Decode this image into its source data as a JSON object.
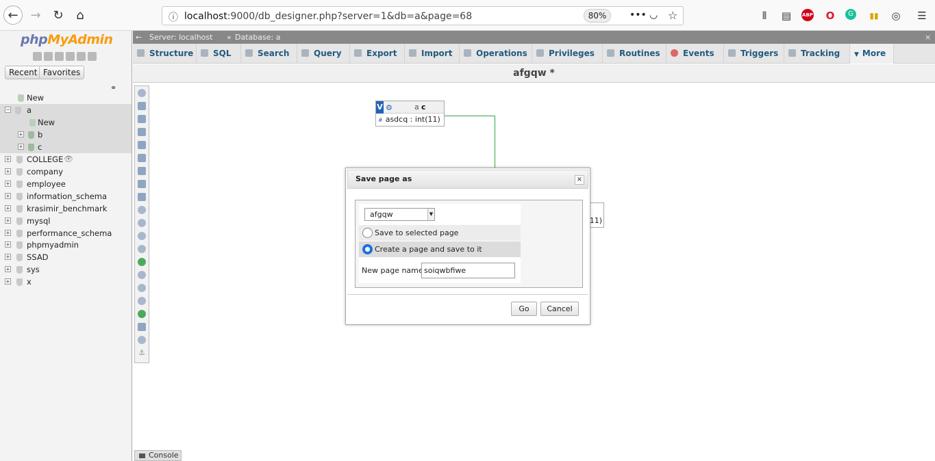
{
  "browser": {
    "url_prefix": "localhost",
    "url_rest": ":9000/db_designer.php?server=1&db=a&page=68",
    "zoom": "80%",
    "icons": [
      "back-icon",
      "forward-icon",
      "reload-icon",
      "home-icon",
      "info-icon",
      "more-icon",
      "pocket-icon",
      "star-icon",
      "library-icon",
      "sidebar-icon",
      "adblock-icon",
      "opera-icon",
      "grammarly-icon",
      "extension-icon",
      "account-icon",
      "menu-icon"
    ]
  },
  "nav": {
    "logo_php": "php",
    "logo_myadmin": "MyAdmin",
    "tabs": {
      "recent": "Recent",
      "favorites": "Favorites"
    },
    "tree": [
      {
        "label": "New"
      },
      {
        "label": "a"
      },
      {
        "label": "New"
      },
      {
        "label": "b"
      },
      {
        "label": "c"
      },
      {
        "label": "COLLEGE"
      },
      {
        "label": "company"
      },
      {
        "label": "employee"
      },
      {
        "label": "information_schema"
      },
      {
        "label": "krasimir_benchmark"
      },
      {
        "label": "mysql"
      },
      {
        "label": "performance_schema"
      },
      {
        "label": "phpmyadmin"
      },
      {
        "label": "SSAD"
      },
      {
        "label": "sys"
      },
      {
        "label": "x"
      }
    ]
  },
  "breadcrumb": {
    "server": "Server: localhost",
    "sep": "»",
    "database": "Database: a"
  },
  "menu": [
    "Structure",
    "SQL",
    "Search",
    "Query",
    "Export",
    "Import",
    "Operations",
    "Privileges",
    "Routines",
    "Events",
    "Triggers",
    "Tracking",
    "More"
  ],
  "designer": {
    "page_title": "afgqw *",
    "table": {
      "badge": "V",
      "db": "a",
      "name": "c",
      "column": "asdcq : int(11)"
    },
    "peek_text": "11)"
  },
  "dialog": {
    "title": "Save page as",
    "close": "×",
    "select_value": "afgqw",
    "radio_save_selected": "Save to selected page",
    "radio_create": "Create a page and save to it",
    "new_page_label": "New page name",
    "new_page_value": "soiqwbfiwe",
    "go": "Go",
    "cancel": "Cancel"
  },
  "console": {
    "label": "Console"
  }
}
